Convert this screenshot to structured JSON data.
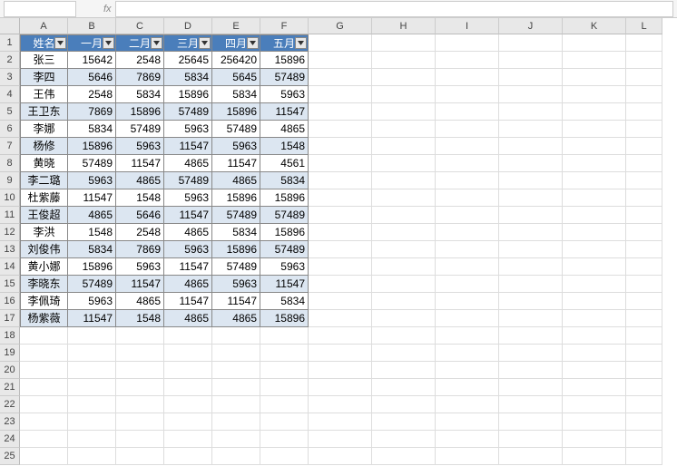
{
  "formula_bar": {
    "name_box": "",
    "fx": "fx"
  },
  "columns": [
    "A",
    "B",
    "C",
    "D",
    "E",
    "F",
    "G",
    "H",
    "I",
    "J",
    "K",
    "L"
  ],
  "row_count": 25,
  "table": {
    "headers": [
      "姓名",
      "一月",
      "二月",
      "三月",
      "四月",
      "五月"
    ],
    "rows": [
      {
        "name": "张三",
        "v": [
          "15642",
          "2548",
          "25645",
          "256420",
          "15896"
        ]
      },
      {
        "name": "李四",
        "v": [
          "5646",
          "7869",
          "5834",
          "5645",
          "57489"
        ]
      },
      {
        "name": "王伟",
        "v": [
          "2548",
          "5834",
          "15896",
          "5834",
          "5963"
        ]
      },
      {
        "name": "王卫东",
        "v": [
          "7869",
          "15896",
          "57489",
          "15896",
          "11547"
        ]
      },
      {
        "name": "李娜",
        "v": [
          "5834",
          "57489",
          "5963",
          "57489",
          "4865"
        ]
      },
      {
        "name": "杨修",
        "v": [
          "15896",
          "5963",
          "11547",
          "5963",
          "1548"
        ]
      },
      {
        "name": "黄晓",
        "v": [
          "57489",
          "11547",
          "4865",
          "11547",
          "4561"
        ]
      },
      {
        "name": "李二璐",
        "v": [
          "5963",
          "4865",
          "57489",
          "4865",
          "5834"
        ]
      },
      {
        "name": "杜紫藤",
        "v": [
          "11547",
          "1548",
          "5963",
          "15896",
          "15896"
        ]
      },
      {
        "name": "王俊超",
        "v": [
          "4865",
          "5646",
          "11547",
          "57489",
          "57489"
        ]
      },
      {
        "name": "李洪",
        "v": [
          "1548",
          "2548",
          "4865",
          "5834",
          "15896"
        ]
      },
      {
        "name": "刘俊伟",
        "v": [
          "5834",
          "7869",
          "5963",
          "15896",
          "57489"
        ]
      },
      {
        "name": "黄小娜",
        "v": [
          "15896",
          "5963",
          "11547",
          "57489",
          "5963"
        ]
      },
      {
        "name": "李晓东",
        "v": [
          "57489",
          "11547",
          "4865",
          "5963",
          "11547"
        ]
      },
      {
        "name": "李佩琦",
        "v": [
          "5963",
          "4865",
          "11547",
          "11547",
          "5834"
        ]
      },
      {
        "name": "杨紫薇",
        "v": [
          "11547",
          "1548",
          "4865",
          "4865",
          "15896"
        ]
      }
    ]
  },
  "chart_data": {
    "type": "table",
    "title": "",
    "categories": [
      "姓名",
      "一月",
      "二月",
      "三月",
      "四月",
      "五月"
    ],
    "series": [
      {
        "name": "张三",
        "values": [
          15642,
          2548,
          25645,
          256420,
          15896
        ]
      },
      {
        "name": "李四",
        "values": [
          5646,
          7869,
          5834,
          5645,
          57489
        ]
      },
      {
        "name": "王伟",
        "values": [
          2548,
          5834,
          15896,
          5834,
          5963
        ]
      },
      {
        "name": "王卫东",
        "values": [
          7869,
          15896,
          57489,
          15896,
          11547
        ]
      },
      {
        "name": "李娜",
        "values": [
          5834,
          57489,
          5963,
          57489,
          4865
        ]
      },
      {
        "name": "杨修",
        "values": [
          15896,
          5963,
          11547,
          5963,
          1548
        ]
      },
      {
        "name": "黄晓",
        "values": [
          57489,
          11547,
          4865,
          11547,
          4561
        ]
      },
      {
        "name": "李二璐",
        "values": [
          5963,
          4865,
          57489,
          4865,
          5834
        ]
      },
      {
        "name": "杜紫藤",
        "values": [
          11547,
          1548,
          5963,
          15896,
          15896
        ]
      },
      {
        "name": "王俊超",
        "values": [
          4865,
          5646,
          11547,
          57489,
          57489
        ]
      },
      {
        "name": "李洪",
        "values": [
          1548,
          2548,
          4865,
          5834,
          15896
        ]
      },
      {
        "name": "刘俊伟",
        "values": [
          5834,
          7869,
          5963,
          15896,
          57489
        ]
      },
      {
        "name": "黄小娜",
        "values": [
          15896,
          5963,
          11547,
          57489,
          5963
        ]
      },
      {
        "name": "李晓东",
        "values": [
          57489,
          11547,
          4865,
          5963,
          11547
        ]
      },
      {
        "name": "李佩琦",
        "values": [
          5963,
          4865,
          11547,
          11547,
          5834
        ]
      },
      {
        "name": "杨紫薇",
        "values": [
          11547,
          1548,
          4865,
          4865,
          15896
        ]
      }
    ]
  }
}
